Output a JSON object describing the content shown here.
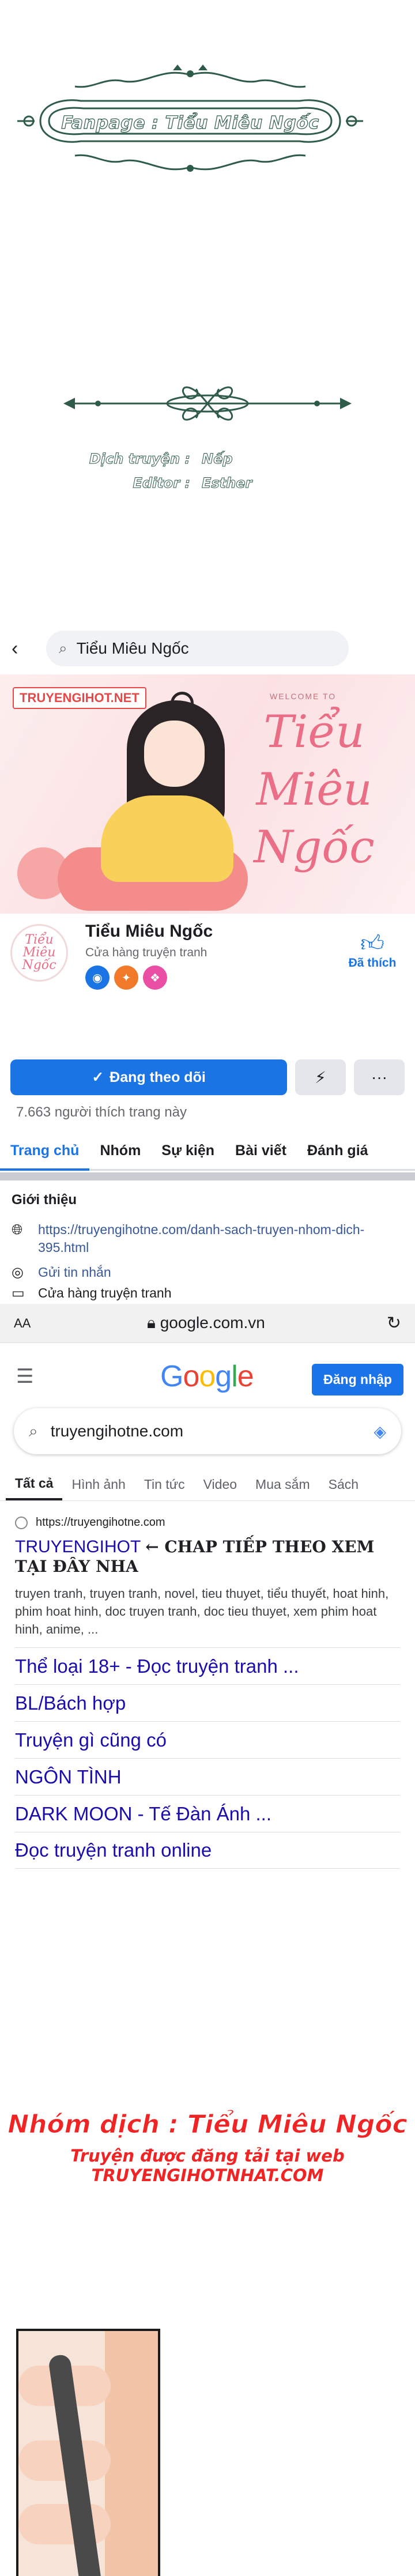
{
  "header": {
    "fanpage": "Fanpage : Tiểu Miêu Ngốc",
    "credits": [
      {
        "role": "Dịch truyện :",
        "name": "Nếp"
      },
      {
        "role": "Editor :",
        "name": "Esther"
      }
    ]
  },
  "facebook": {
    "search_text": "Tiểu Miêu Ngốc",
    "cover": {
      "site_badge": "TRUYENGIHOT.NET",
      "welcome": "WELCOME TO",
      "art_title": "Tiểu Miêu Ngốc"
    },
    "page_name": "Tiểu Miêu Ngốc",
    "category": "Cửa hàng truyện tranh",
    "avatar_text": "Tiểu Miêu Ngốc",
    "like_label": "Đã thích",
    "follow_label": "Đang theo dõi",
    "likes_count": "7.663 người thích trang này",
    "tabs": [
      "Trang chủ",
      "Nhóm",
      "Sự kiện",
      "Bài viết",
      "Đánh giá"
    ],
    "intro": {
      "title": "Giới thiệu",
      "link": "https://truyengihotne.com/danh-sach-truyen-nhom-dich-395.html",
      "message": "Gửi tin nhắn",
      "shop": "Cửa hàng truyện tranh"
    }
  },
  "browser": {
    "aa": "AA",
    "url": "google.com.vn",
    "logo": "Google",
    "signin": "Đăng nhập",
    "query": "truyengihotne.com",
    "tabs": [
      "Tất cả",
      "Hình ảnh",
      "Tin tức",
      "Video",
      "Mua sắm",
      "Sách"
    ],
    "result": {
      "site": "https://truyengihotne.com",
      "title": "TRUYENGIHOT",
      "title_note": "← CHAP TIẾP THEO XEM TẠI ĐÂY NHA",
      "snippet": "truyen tranh, truyen tranh, novel, tieu thuyet, tiểu thuyết, hoat hinh, phim hoat hinh, doc truyen tranh, doc tieu thuyet, xem phim hoat hinh, anime, ..."
    },
    "links": [
      "Thể loại 18+ - Đọc truyện tranh ...",
      "BL/Bách hợp",
      "Truyện gì cũng có",
      "NGÔN TÌNH",
      "DARK MOON - Tế Đàn Ánh ...",
      "Đọc truyện tranh online"
    ]
  },
  "footer": {
    "group": "Nhóm dịch : Tiểu Miêu Ngốc",
    "notice": "Truyện được đăng tải tại web TRUYENGIHOTNHAT.COM"
  },
  "colors": {
    "fb_blue": "#1b74e4",
    "google_link": "#1a0dab",
    "ornament_green": "#2f5b49",
    "credit_red": "#ef2525"
  }
}
